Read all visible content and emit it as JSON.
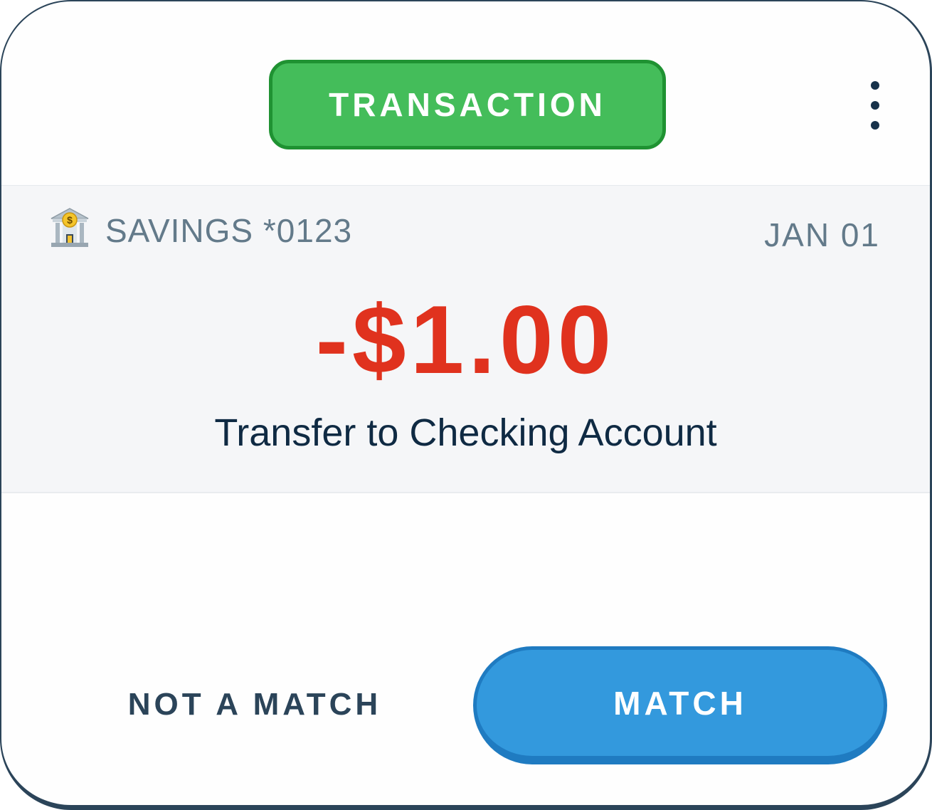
{
  "header": {
    "tag_label": "TRANSACTION",
    "more_icon": "more-vertical-icon",
    "colors": {
      "tag_background": "#44bd5a",
      "tag_border": "#1f9232"
    }
  },
  "transaction": {
    "account_icon": "bank-icon",
    "account_label": "SAVINGS *0123",
    "date": "JAN 01",
    "amount": "-$1.00",
    "description": "Transfer to Checking Account",
    "colors": {
      "amount": "#e0321e"
    }
  },
  "actions": {
    "not_match_label": "NOT A MATCH",
    "match_label": "MATCH",
    "colors": {
      "match_background": "#3399dd"
    }
  }
}
